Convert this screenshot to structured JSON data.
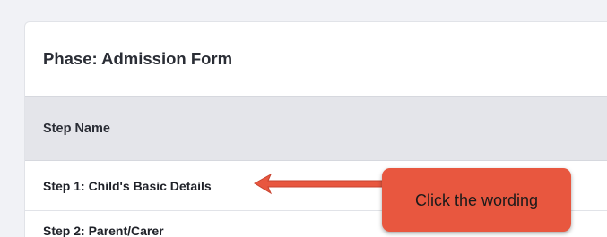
{
  "phase": {
    "title": "Phase: Admission Form"
  },
  "table": {
    "column_header": "Step Name",
    "rows": [
      {
        "label": "Step 1: Child's Basic Details"
      },
      {
        "label": "Step 2: Parent/Carer"
      }
    ]
  },
  "annotation": {
    "callout_text": "Click the wording",
    "color": "#e8573f"
  }
}
